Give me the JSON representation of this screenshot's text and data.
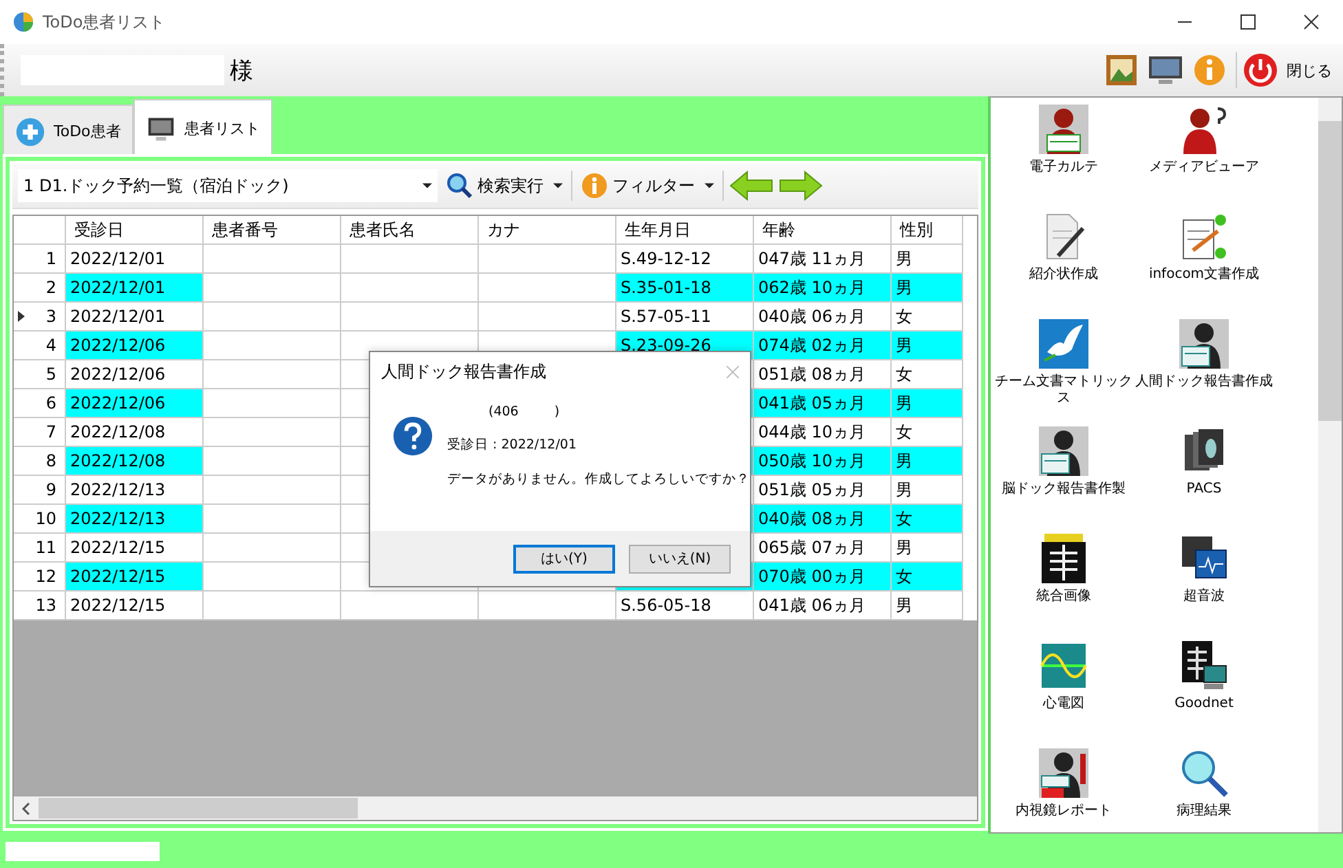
{
  "window": {
    "title": "ToDo患者リスト"
  },
  "header": {
    "honorific": "様",
    "close_label": "閉じる"
  },
  "tabs": [
    {
      "label": "ToDo患者",
      "selected": false
    },
    {
      "label": "患者リスト",
      "selected": true
    }
  ],
  "toolbar": {
    "list_select": "1 D1.ドック予約一覧（宿泊ドック)",
    "search": "検索実行",
    "filter": "フィルター"
  },
  "table": {
    "columns": [
      "受診日",
      "患者番号",
      "患者氏名",
      "カナ",
      "生年月日",
      "年齢",
      "性別"
    ],
    "rows": [
      {
        "no": "1",
        "date": "2022/12/01",
        "birth": "S.49-12-12",
        "age": "047歳 11ヵ月",
        "sex": "男",
        "highlighted": false,
        "current": false
      },
      {
        "no": "2",
        "date": "2022/12/01",
        "birth": "S.35-01-18",
        "age": "062歳 10ヵ月",
        "sex": "男",
        "highlighted": true,
        "current": false
      },
      {
        "no": "3",
        "date": "2022/12/01",
        "birth": "S.57-05-11",
        "age": "040歳 06ヵ月",
        "sex": "女",
        "highlighted": false,
        "current": true
      },
      {
        "no": "4",
        "date": "2022/12/06",
        "birth": "S.23-09-26",
        "age": "074歳 02ヵ月",
        "sex": "男",
        "highlighted": true,
        "current": false
      },
      {
        "no": "5",
        "date": "2022/12/06",
        "age": "051歳 08ヵ月",
        "sex": "女",
        "highlighted": false,
        "current": false
      },
      {
        "no": "6",
        "date": "2022/12/06",
        "age": "041歳 05ヵ月",
        "sex": "男",
        "highlighted": true,
        "current": false
      },
      {
        "no": "7",
        "date": "2022/12/08",
        "age": "044歳 10ヵ月",
        "sex": "女",
        "highlighted": false,
        "current": false
      },
      {
        "no": "8",
        "date": "2022/12/08",
        "age": "050歳 10ヵ月",
        "sex": "男",
        "highlighted": true,
        "current": false
      },
      {
        "no": "9",
        "date": "2022/12/13",
        "age": "051歳 05ヵ月",
        "sex": "男",
        "highlighted": false,
        "current": false
      },
      {
        "no": "10",
        "date": "2022/12/13",
        "age": "040歳 08ヵ月",
        "sex": "女",
        "highlighted": true,
        "current": false
      },
      {
        "no": "11",
        "date": "2022/12/15",
        "age": "065歳 07ヵ月",
        "sex": "男",
        "highlighted": false,
        "current": false
      },
      {
        "no": "12",
        "date": "2022/12/15",
        "age": "070歳 00ヵ月",
        "sex": "女",
        "highlighted": true,
        "current": false
      },
      {
        "no": "13",
        "date": "2022/12/15",
        "birth": "S.56-05-18",
        "age": "041歳 06ヵ月",
        "sex": "男",
        "highlighted": false,
        "current": false
      }
    ]
  },
  "dialog": {
    "title": "人間ドック報告書作成",
    "code_open": "(406",
    "code_close": ")",
    "visit": "受診日 : 2022/12/01",
    "message": "データがありません。作成してよろしいですか？",
    "buttons": [
      {
        "label": "はい(Y)",
        "selected": true
      },
      {
        "label": "いいえ(N)",
        "selected": false
      }
    ]
  },
  "launcher": {
    "items": [
      "電子カルテ",
      "メディアビューア",
      "紹介状作成",
      "infocom文書作成",
      "チーム文書マトリックス",
      "人間ドック報告書作成",
      "脳ドック報告書作製",
      "PACS",
      "統合画像",
      "超音波",
      "心電図",
      "Goodnet",
      "内視鏡レポート",
      "病理結果"
    ]
  }
}
